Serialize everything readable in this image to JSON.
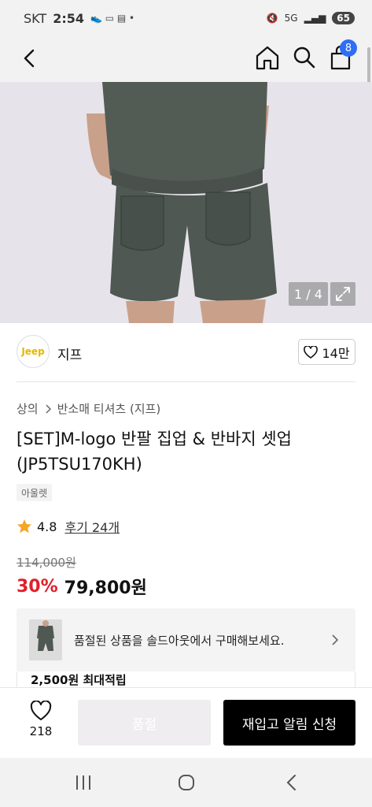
{
  "status_bar": {
    "carrier": "SKT",
    "time": "2:54",
    "battery": "65",
    "network": "5G"
  },
  "nav": {
    "cart_count": "8"
  },
  "gallery": {
    "counter": "1 / 4"
  },
  "brand": {
    "logo_text": "Jeep",
    "name": "지프",
    "likes": "14만"
  },
  "breadcrumb": {
    "category": "상의",
    "subcategory": "반소매 티셔츠 (지프)"
  },
  "product": {
    "title": "[SET]M-logo 반팔 집업 & 반바지 셋업 (JP5TSU170KH)",
    "tag": "아울렛",
    "rating": "4.8",
    "reviews": "후기 24개",
    "original_price": "114,000원",
    "discount": "30%",
    "price": "79,800원"
  },
  "soldout_banner": {
    "text": "품절된 상품을 솔드아웃에서 구매해보세요."
  },
  "points": {
    "text": "2,500원 최대적립"
  },
  "action_bar": {
    "wish_count": "218",
    "soldout_label": "품절",
    "restock_label": "재입고 알림 신청"
  },
  "colors": {
    "accent_blue": "#2e6ef5",
    "discount_red": "#e0202c",
    "star": "#f5a623",
    "primary_button": "#000000"
  }
}
